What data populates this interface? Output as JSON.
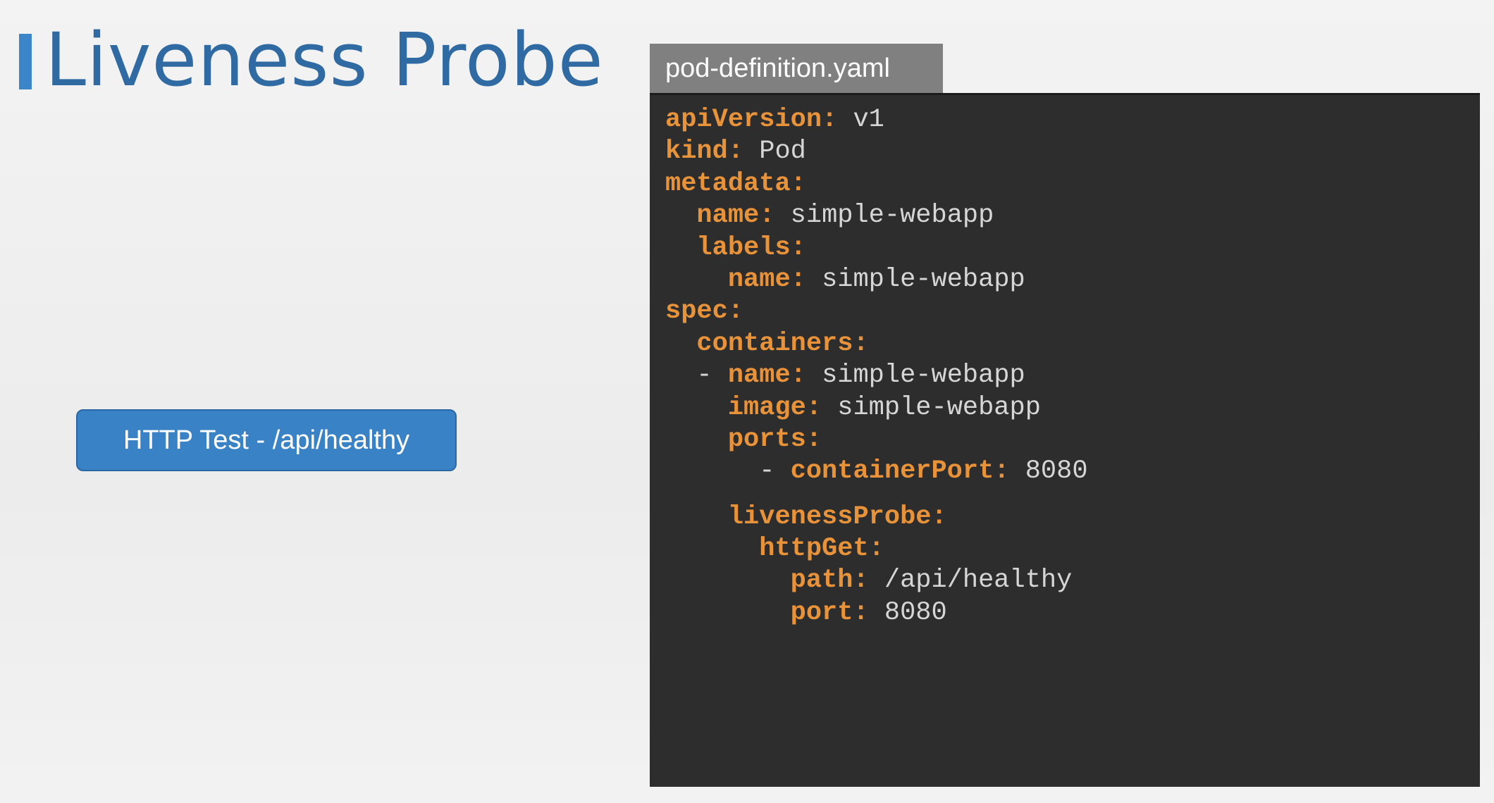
{
  "title": "Liveness Probe",
  "button_label": "HTTP Test - /api/healthy",
  "file_tab": "pod-definition.yaml",
  "colors": {
    "accent": "#3a82c6",
    "title": "#2f6aa3",
    "yaml_key": "#e8923a",
    "yaml_value": "#d6d6d6",
    "code_bg": "#2d2d2d"
  },
  "code_lines": [
    {
      "indent": "",
      "key": "apiVersion:",
      "value": " v1"
    },
    {
      "indent": "",
      "key": "kind:",
      "value": " Pod"
    },
    {
      "indent": "",
      "key": "metadata:",
      "value": ""
    },
    {
      "indent": "  ",
      "key": "name:",
      "value": " simple-webapp"
    },
    {
      "indent": "  ",
      "key": "labels:",
      "value": ""
    },
    {
      "indent": "    ",
      "key": "name:",
      "value": " simple-webapp"
    },
    {
      "indent": "",
      "key": "spec:",
      "value": ""
    },
    {
      "indent": "  ",
      "key": "containers:",
      "value": ""
    },
    {
      "indent": "  - ",
      "key": "name:",
      "value": " simple-webapp"
    },
    {
      "indent": "    ",
      "key": "image:",
      "value": " simple-webapp"
    },
    {
      "indent": "    ",
      "key": "ports:",
      "value": ""
    },
    {
      "indent": "      - ",
      "key": "containerPort:",
      "value": " 8080"
    },
    {
      "indent": "    ",
      "key": "livenessProbe:",
      "value": "",
      "gap": true
    },
    {
      "indent": "      ",
      "key": "httpGet:",
      "value": ""
    },
    {
      "indent": "        ",
      "key": "path:",
      "value": " /api/healthy"
    },
    {
      "indent": "        ",
      "key": "port:",
      "value": " 8080"
    }
  ]
}
